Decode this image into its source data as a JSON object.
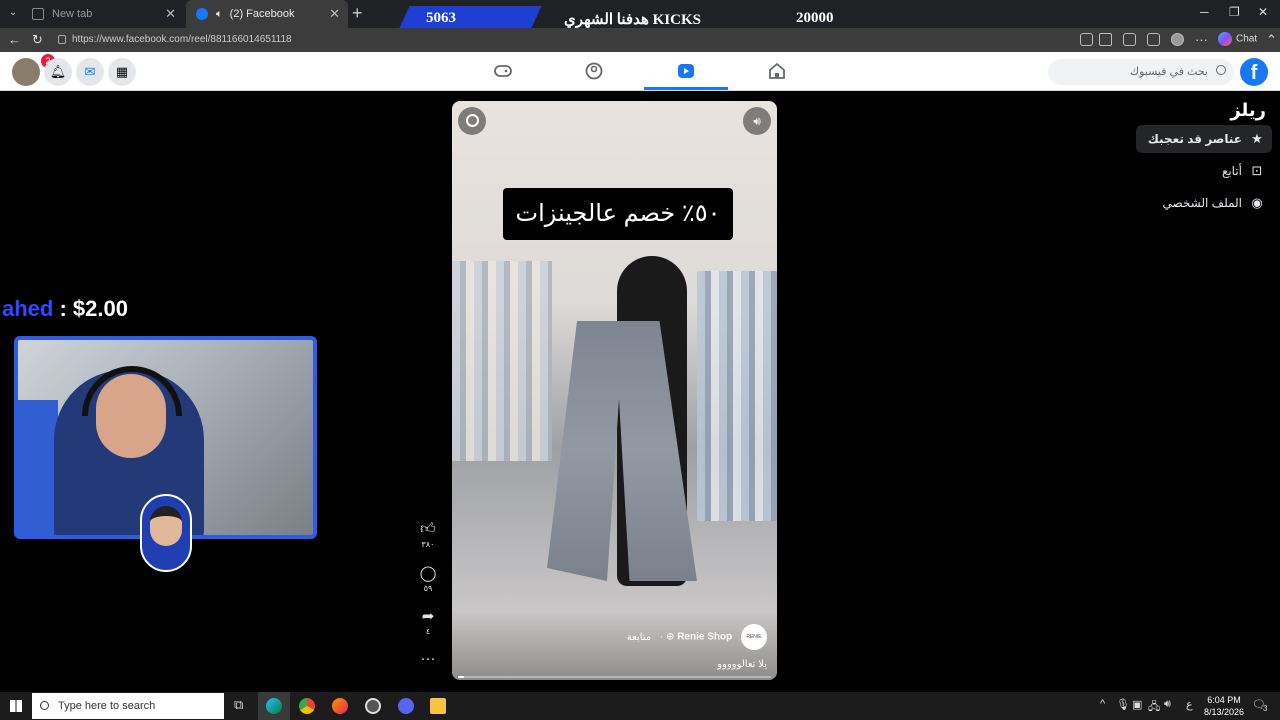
{
  "browser": {
    "tabs": [
      {
        "label": "New tab"
      },
      {
        "label": "(2) Facebook"
      }
    ],
    "url": "https://www.facebook.com/reel/881166014651118",
    "chat_label": "Chat"
  },
  "stream_overlay": {
    "left_number": "5063",
    "goal_text": "هدفنا الشهري KICKS",
    "right_number": "20000",
    "donor_name": "ahed",
    "donation_amount": ": $2.00"
  },
  "facebook": {
    "notification_count": "2",
    "search_placeholder": "بحث في فيسبوك",
    "logo": "f",
    "sidebar": {
      "title": "ريلز",
      "items": [
        {
          "label": "عناصر قد تعجبك",
          "icon": "star-icon",
          "active": true
        },
        {
          "label": "أتابع",
          "icon": "following-icon",
          "active": false
        },
        {
          "label": "الملف الشخصي",
          "icon": "profile-icon",
          "active": false
        }
      ]
    },
    "reel": {
      "caption": "٥٠٪ خصم عالجينزات",
      "shop_name": "Renie Shop",
      "follow_label": "متابعة",
      "separator": "·",
      "description": "يلا تعالووووو",
      "shop_logo_text": "RENIE",
      "progress": 0.02
    },
    "actions": [
      {
        "icon": "like-icon",
        "count": "٣٨٠"
      },
      {
        "icon": "comment-icon",
        "count": "٥٩"
      },
      {
        "icon": "share-icon",
        "count": "٤"
      },
      {
        "icon": "more-icon",
        "count": ""
      }
    ]
  },
  "taskbar": {
    "search_placeholder": "Type here to search",
    "time": "6:04 PM",
    "date": "8/13/2026",
    "notification_count": "3",
    "lang": "ع"
  }
}
